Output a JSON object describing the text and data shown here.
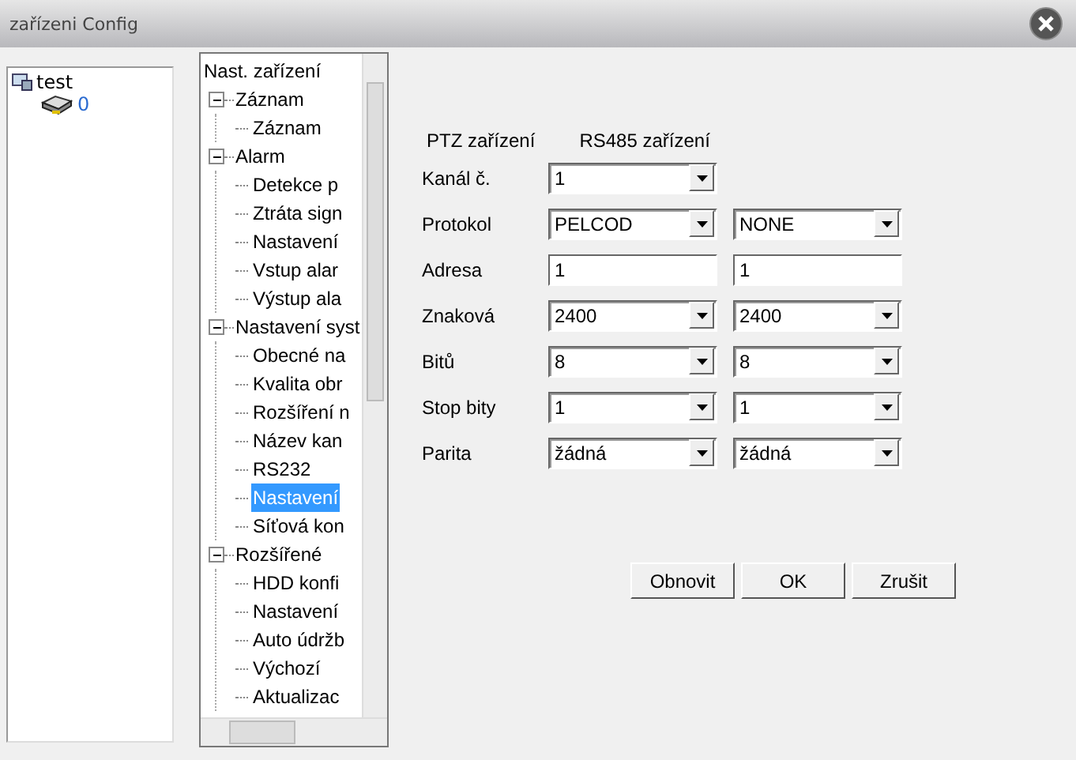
{
  "window": {
    "title": "zařízeni Config"
  },
  "device_tree": {
    "label": "test",
    "children": [
      {
        "label": "0"
      }
    ]
  },
  "menu_tree": {
    "label": "Nast. zařízení",
    "children": [
      {
        "label": "Záznam",
        "expanded": true,
        "children": [
          {
            "label": "Záznam",
            "selected": false
          }
        ]
      },
      {
        "label": "Alarm",
        "expanded": true,
        "children": [
          {
            "label": "Detekce p",
            "selected": false
          },
          {
            "label": "Ztráta sign",
            "selected": false
          },
          {
            "label": "Nastavení",
            "selected": false
          },
          {
            "label": "Vstup alar",
            "selected": false
          },
          {
            "label": "Výstup ala",
            "selected": false
          }
        ]
      },
      {
        "label": "Nastavení syst",
        "expanded": true,
        "children": [
          {
            "label": "Obecné na",
            "selected": false
          },
          {
            "label": "Kvalita obr",
            "selected": false
          },
          {
            "label": "Rozšíření n",
            "selected": false
          },
          {
            "label": "Název kan",
            "selected": false
          },
          {
            "label": "RS232",
            "selected": false
          },
          {
            "label": "Nastavení",
            "selected": true
          },
          {
            "label": "Síťová kon",
            "selected": false
          }
        ]
      },
      {
        "label": "Rozšířené",
        "expanded": true,
        "children": [
          {
            "label": "HDD konfi",
            "selected": false
          },
          {
            "label": "Nastavení",
            "selected": false
          },
          {
            "label": "Auto údržb",
            "selected": false
          },
          {
            "label": "Výchozí",
            "selected": false
          },
          {
            "label": "Aktualizac",
            "selected": false
          }
        ]
      }
    ]
  },
  "form": {
    "headers": [
      "PTZ zařízení",
      "RS485 zařízení"
    ],
    "rows": [
      {
        "label": "Kanál č.",
        "fields": [
          {
            "kind": "combo",
            "value": "1"
          }
        ]
      },
      {
        "label": "Protokol",
        "fields": [
          {
            "kind": "combo",
            "value": "PELCOD"
          },
          {
            "kind": "combo",
            "value": "NONE"
          }
        ]
      },
      {
        "label": "Adresa",
        "fields": [
          {
            "kind": "text",
            "value": "1"
          },
          {
            "kind": "text",
            "value": "1"
          }
        ]
      },
      {
        "label": "Znaková",
        "fields": [
          {
            "kind": "combo",
            "value": "2400"
          },
          {
            "kind": "combo",
            "value": "2400"
          }
        ]
      },
      {
        "label": "Bitů",
        "fields": [
          {
            "kind": "combo",
            "value": "8"
          },
          {
            "kind": "combo",
            "value": "8"
          }
        ]
      },
      {
        "label": "Stop bity",
        "fields": [
          {
            "kind": "combo",
            "value": "1"
          },
          {
            "kind": "combo",
            "value": "1"
          }
        ]
      },
      {
        "label": "Parita",
        "fields": [
          {
            "kind": "combo",
            "value": "žádná"
          },
          {
            "kind": "combo",
            "value": "žádná"
          }
        ]
      }
    ]
  },
  "buttons": [
    "Obnovit",
    "OK",
    "Zrušit"
  ]
}
